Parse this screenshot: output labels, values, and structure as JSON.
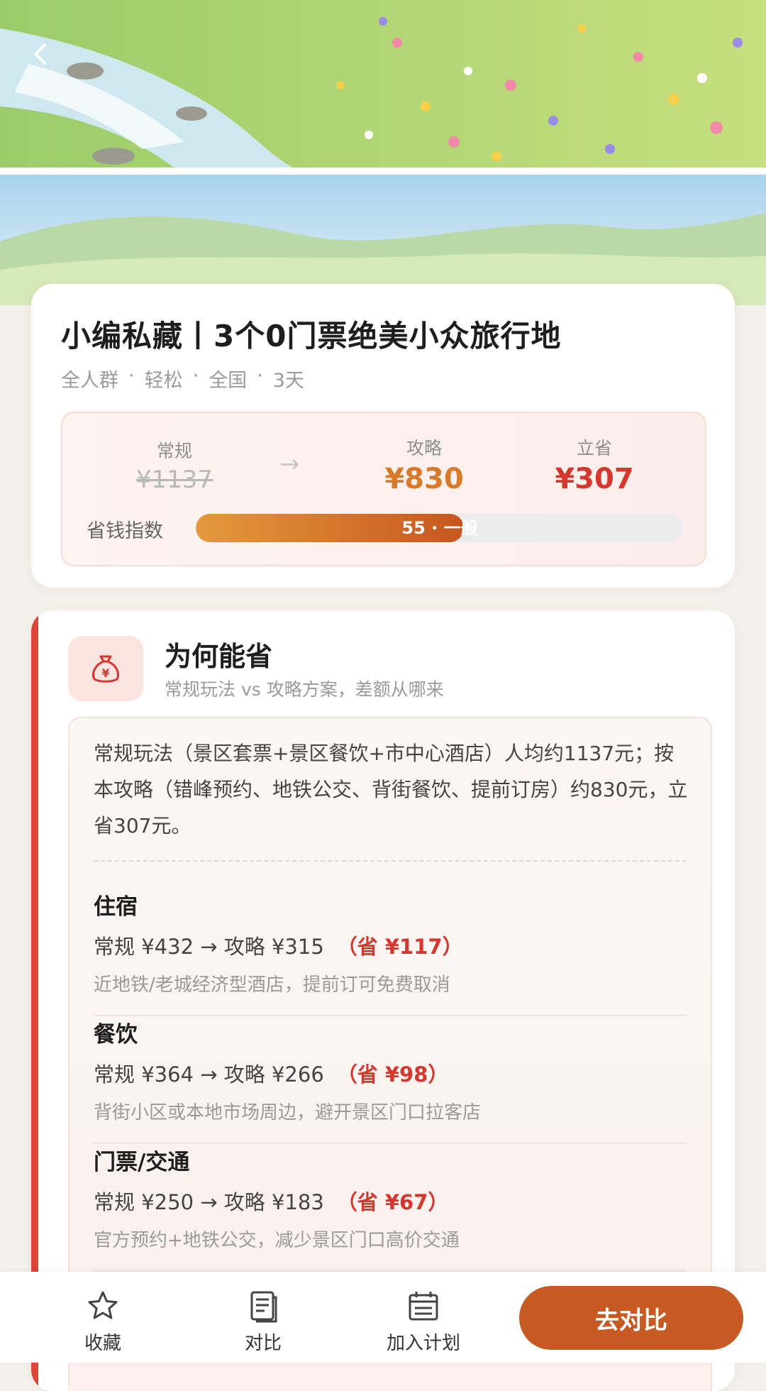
{
  "header": {
    "back_icon": "chevron-left-icon"
  },
  "title_card": {
    "title": "小编私藏丨3个0门票绝美小众旅行地",
    "tags": [
      "全人群",
      "轻松",
      "全国",
      "3天"
    ],
    "tag_separator": "·",
    "price": {
      "regular_label": "常规",
      "regular_value": "¥1137",
      "arrow": "→",
      "plan_label": "攻略",
      "plan_value": "¥830",
      "save_label": "立省",
      "save_value": "¥307"
    },
    "savings_index": {
      "label": "省钱指数",
      "value": 55,
      "max": 100,
      "text": "55 · 一般"
    }
  },
  "why_section": {
    "icon": "money-bag-icon",
    "title": "为何能省",
    "subtitle": "常规玩法 vs 攻略方案，差额从哪来",
    "description": "常规玩法（景区套票+景区餐饮+市中心酒店）人均约1137元；按本攻略（错峰预约、地铁公交、背街餐饮、提前订房）约830元，立省307元。",
    "items": [
      {
        "name": "住宿",
        "compare": "常规 ¥432 → 攻略 ¥315",
        "save": "（省 ¥117）",
        "note": "近地铁/老城经济型酒店，提前订可免费取消"
      },
      {
        "name": "餐饮",
        "compare": "常规 ¥364 → 攻略 ¥266",
        "save": "（省 ¥98）",
        "note": "背街小区或本地市场周边，避开景区门口拉客店"
      },
      {
        "name": "门票/交通",
        "compare": "常规 ¥250 → 攻略 ¥183",
        "save": "（省 ¥67）",
        "note": "官方预约+地铁公交，减少景区门口高价交通"
      }
    ]
  },
  "bottom_bar": {
    "tabs": [
      {
        "icon": "star-icon",
        "label": "收藏"
      },
      {
        "icon": "document-icon",
        "label": "对比"
      },
      {
        "icon": "calendar-icon",
        "label": "加入计划"
      }
    ],
    "cta_label": "去对比"
  },
  "colors": {
    "accent_red": "#d5372e",
    "accent_orange": "#d97a2b",
    "cta": "#c65a22"
  }
}
